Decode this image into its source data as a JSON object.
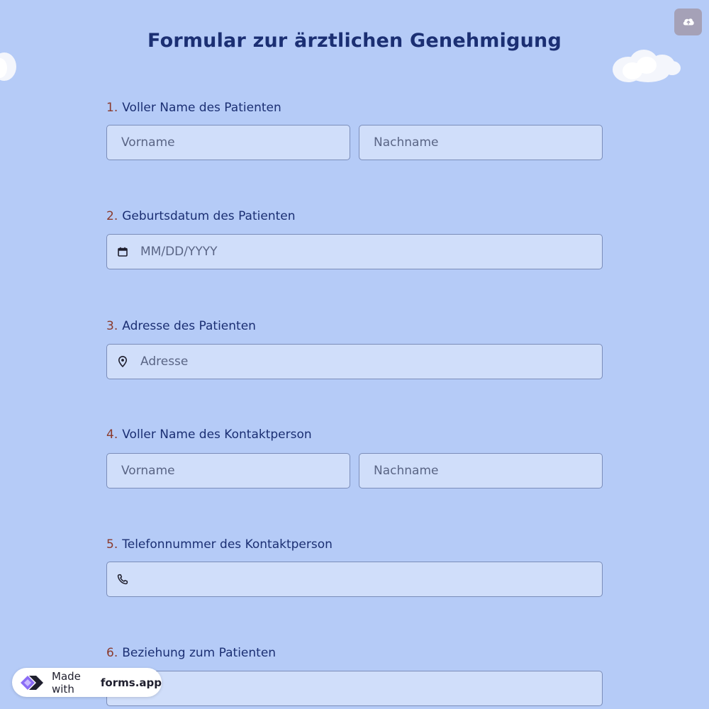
{
  "form": {
    "title": "Formular zur ärztlichen Genehmigung"
  },
  "questions": [
    {
      "number": "1.",
      "label": "Voller Name des Patienten",
      "fields": [
        {
          "placeholder": "Vorname"
        },
        {
          "placeholder": "Nachname"
        }
      ]
    },
    {
      "number": "2.",
      "label": "Geburtsdatum des Patienten",
      "fields": [
        {
          "placeholder": "MM/DD/YYYY",
          "icon": "calendar-icon"
        }
      ]
    },
    {
      "number": "3.",
      "label": "Adresse des Patienten",
      "fields": [
        {
          "placeholder": "Adresse",
          "icon": "map-pin-icon"
        }
      ]
    },
    {
      "number": "4.",
      "label": "Voller Name des Kontaktperson",
      "fields": [
        {
          "placeholder": "Vorname"
        },
        {
          "placeholder": "Nachname"
        }
      ]
    },
    {
      "number": "5.",
      "label": "Telefonnummer des Kontaktperson",
      "fields": [
        {
          "placeholder": "",
          "icon": "phone-icon"
        }
      ]
    },
    {
      "number": "6.",
      "label": "Beziehung zum Patienten",
      "fields": [
        {
          "placeholder": ""
        }
      ]
    }
  ],
  "badge": {
    "prefix": "Made with",
    "brand": "forms.app"
  },
  "colors": {
    "background": "#b5cbf7",
    "field_background": "#d0defa",
    "title": "#1b2f73",
    "number_accent": "#8a3a2c"
  }
}
